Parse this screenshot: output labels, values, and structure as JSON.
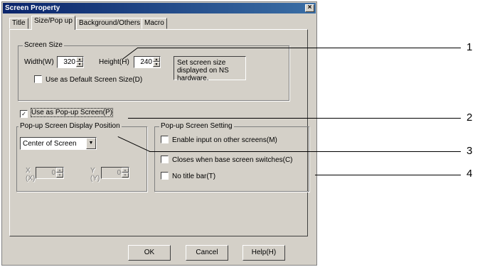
{
  "window": {
    "title": "Screen Property",
    "close_label": "×"
  },
  "tabs": [
    {
      "label": "Title"
    },
    {
      "label": "Size/Pop up"
    },
    {
      "label": "Background/Others"
    },
    {
      "label": "Macro"
    }
  ],
  "screen_size": {
    "legend": "Screen Size",
    "width_label": "Width(W)",
    "width_value": "320",
    "height_label": "Height(H)",
    "height_value": "240",
    "info_text": "Set screen size displayed on NS hardware.",
    "default_checkbox_label": "Use as Default Screen Size(D)"
  },
  "popup": {
    "use_popup_label": "Use as Pop-up Screen(P)",
    "use_popup_checked": true,
    "position_group": {
      "legend": "Pop-up Screen Display Position",
      "select_value": "Center of Screen",
      "x_label": "X (X)",
      "x_value": "0",
      "y_label": "Y (Y)",
      "y_value": "0"
    },
    "setting_group": {
      "legend": "Pop-up Screen Setting",
      "options": [
        {
          "label": "Enable input on other screens(M)",
          "checked": false
        },
        {
          "label": "Closes when base screen switches(C)",
          "checked": false
        },
        {
          "label": "No title bar(T)",
          "checked": false
        }
      ]
    }
  },
  "buttons": {
    "ok": "OK",
    "cancel": "Cancel",
    "help": "Help(H)"
  },
  "callouts": [
    "1",
    "2",
    "3",
    "4"
  ]
}
